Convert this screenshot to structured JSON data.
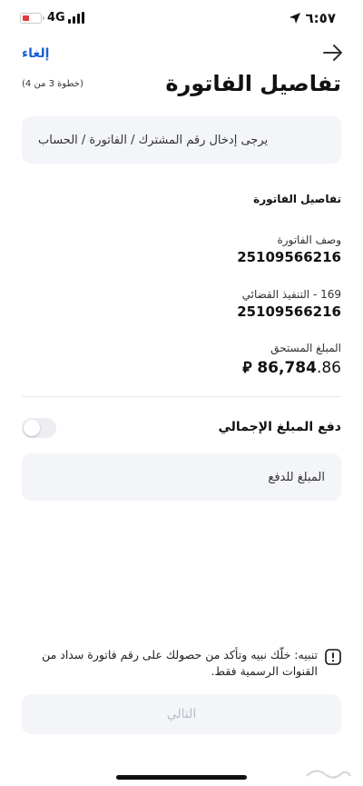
{
  "status_bar": {
    "network": "4G",
    "time": "٦:٥٧",
    "battery_level": 0.35,
    "battery_color": "#e23b3b",
    "location_icon": "location-arrow-icon"
  },
  "header": {
    "cancel_label": "إلغاء",
    "back_icon": "arrow-right-icon",
    "title": "تفاصيل الفاتورة",
    "step": "(خطوة 3 من 4)"
  },
  "info_box": {
    "text": "يرجى إدخال رقم المشترك / الفاتورة / الحساب"
  },
  "bill_details": {
    "section_title": "تفاصيل الفاتورة",
    "fields": [
      {
        "label": "وصف الفاتورة",
        "value": "25109566216"
      },
      {
        "label": "169 - التنفيذ القضائي",
        "value": "25109566216"
      }
    ],
    "due": {
      "label": "المبلغ المستحق",
      "currency_symbol": "⃁",
      "amount_int": "86,784",
      "amount_dec": ".86"
    }
  },
  "total_payment": {
    "label": "دفع المبلغ الإجمالي",
    "toggle_on": false
  },
  "payment_input": {
    "placeholder": "المبلغ للدفع"
  },
  "warning": {
    "icon": "exclamation-square-icon",
    "text": "تنبيه: خلّك نبيه وتأكد من حصولك على رقم فاتورة سداد من القنوات الرسمية فقط."
  },
  "next_button": {
    "label": "التالي"
  },
  "colors": {
    "accent": "#1b5fd6",
    "field_bg": "#f3f5f9",
    "disabled_text": "#b8bdc6"
  }
}
